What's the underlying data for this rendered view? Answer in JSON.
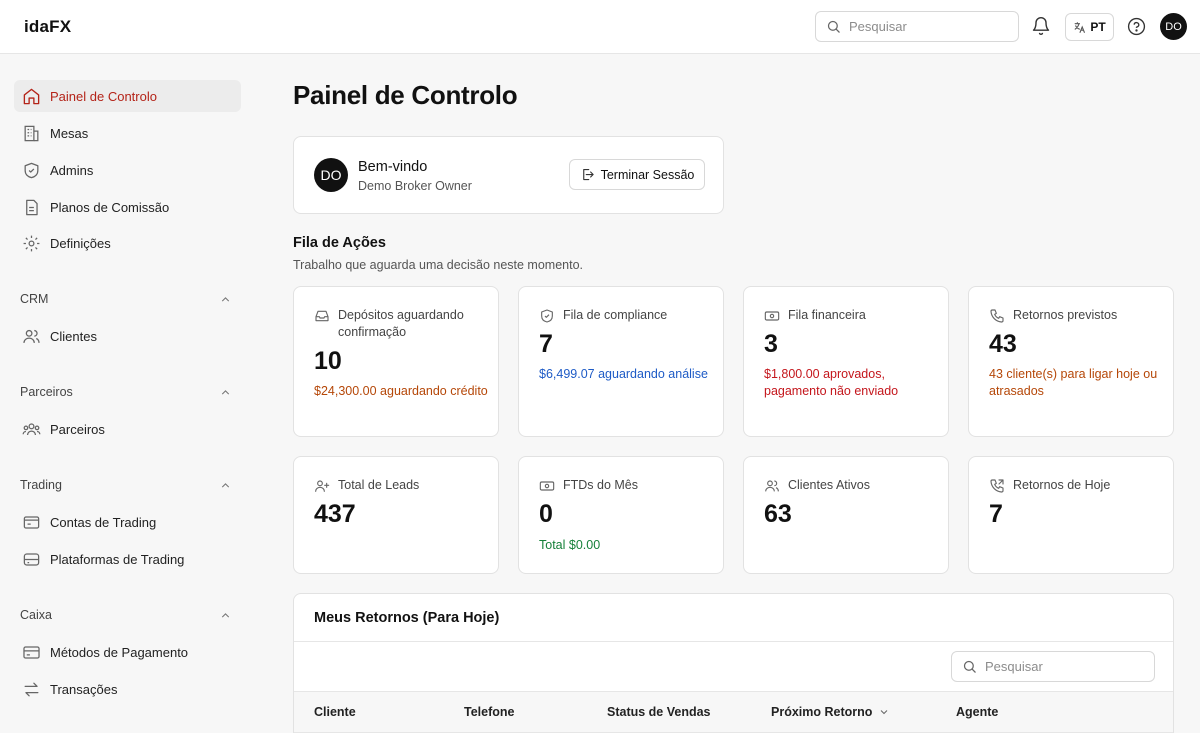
{
  "header": {
    "brand": "idaFX",
    "search_placeholder": "Pesquisar",
    "lang": "PT",
    "user_initials": "DO"
  },
  "sidebar": {
    "items": [
      {
        "label": "Painel de Controlo",
        "icon": "home-icon",
        "active": true
      },
      {
        "label": "Mesas",
        "icon": "building-icon"
      },
      {
        "label": "Admins",
        "icon": "shield-icon"
      },
      {
        "label": "Planos de Comissão",
        "icon": "document-icon"
      },
      {
        "label": "Definições",
        "icon": "gear-icon"
      }
    ],
    "sections": [
      {
        "title": "CRM",
        "items": [
          {
            "label": "Clientes",
            "icon": "users-icon"
          }
        ]
      },
      {
        "title": "Parceiros",
        "items": [
          {
            "label": "Parceiros",
            "icon": "partners-icon"
          }
        ]
      },
      {
        "title": "Trading",
        "items": [
          {
            "label": "Contas de Trading",
            "icon": "wallet-icon"
          },
          {
            "label": "Plataformas de Trading",
            "icon": "server-icon"
          }
        ]
      },
      {
        "title": "Caixa",
        "items": [
          {
            "label": "Métodos de Pagamento",
            "icon": "credit-card-icon"
          },
          {
            "label": "Transações",
            "icon": "arrows-icon"
          }
        ]
      }
    ]
  },
  "main": {
    "title": "Painel de Controlo",
    "welcome": {
      "initials": "DO",
      "greeting": "Bem-vindo",
      "role": "Demo Broker Owner",
      "logout_label": "Terminar Sessão"
    },
    "queue": {
      "title": "Fila de Ações",
      "subtitle": "Trabalho que aguarda uma decisão neste momento.",
      "cards": [
        {
          "label": "Depósitos aguardando confirmação",
          "value": "10",
          "note": "$24,300.00 aguardando crédito",
          "note_color": "#b54708",
          "icon": "inbox-icon"
        },
        {
          "label": "Fila de compliance",
          "value": "7",
          "note": "$6,499.07 aguardando análise",
          "note_color": "#1e5bc6",
          "icon": "shield-check-icon"
        },
        {
          "label": "Fila financeira",
          "value": "3",
          "note": "$1,800.00 aprovados, pagamento não enviado",
          "note_color": "#c4161c",
          "icon": "banknote-icon"
        },
        {
          "label": "Retornos previstos",
          "value": "43",
          "note": "43 cliente(s) para ligar hoje ou atrasados",
          "note_color": "#b54708",
          "icon": "phone-icon"
        }
      ]
    },
    "stats": [
      {
        "label": "Total de Leads",
        "value": "437",
        "note": "",
        "icon": "user-plus-icon"
      },
      {
        "label": "FTDs do Mês",
        "value": "0",
        "note": "Total $0.00",
        "note_color": "#16813a",
        "icon": "banknote-icon"
      },
      {
        "label": "Clientes Ativos",
        "value": "63",
        "note": "",
        "icon": "users-icon"
      },
      {
        "label": "Retornos de Hoje",
        "value": "7",
        "note": "",
        "icon": "phone-outgoing-icon"
      }
    ],
    "returns": {
      "title": "Meus Retornos (Para Hoje)",
      "search_placeholder": "Pesquisar",
      "columns": [
        "Cliente",
        "Telefone",
        "Status de Vendas",
        "Próximo Retorno",
        "Agente"
      ]
    }
  }
}
